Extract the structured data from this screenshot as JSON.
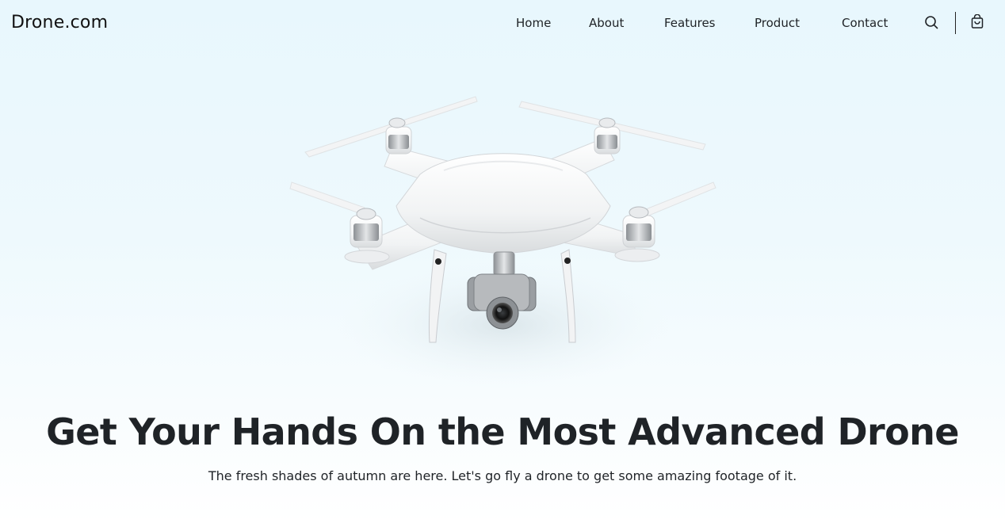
{
  "header": {
    "logo": "Drone.com",
    "nav": [
      {
        "label": "Home"
      },
      {
        "label": "About"
      },
      {
        "label": "Features"
      },
      {
        "label": "Product"
      },
      {
        "label": "Contact"
      }
    ],
    "icons": [
      "search-icon",
      "shopping-bag-icon"
    ]
  },
  "hero": {
    "image": "drone-photo",
    "title": "Get Your Hands On the Most Advanced Drone",
    "subtitle": "The fresh shades of autumn are here. Let's go fly a drone to get some amazing footage of it."
  },
  "colors": {
    "background_top": "#e8f7fd",
    "background_bottom": "#ffffff",
    "text": "#1f2327"
  }
}
